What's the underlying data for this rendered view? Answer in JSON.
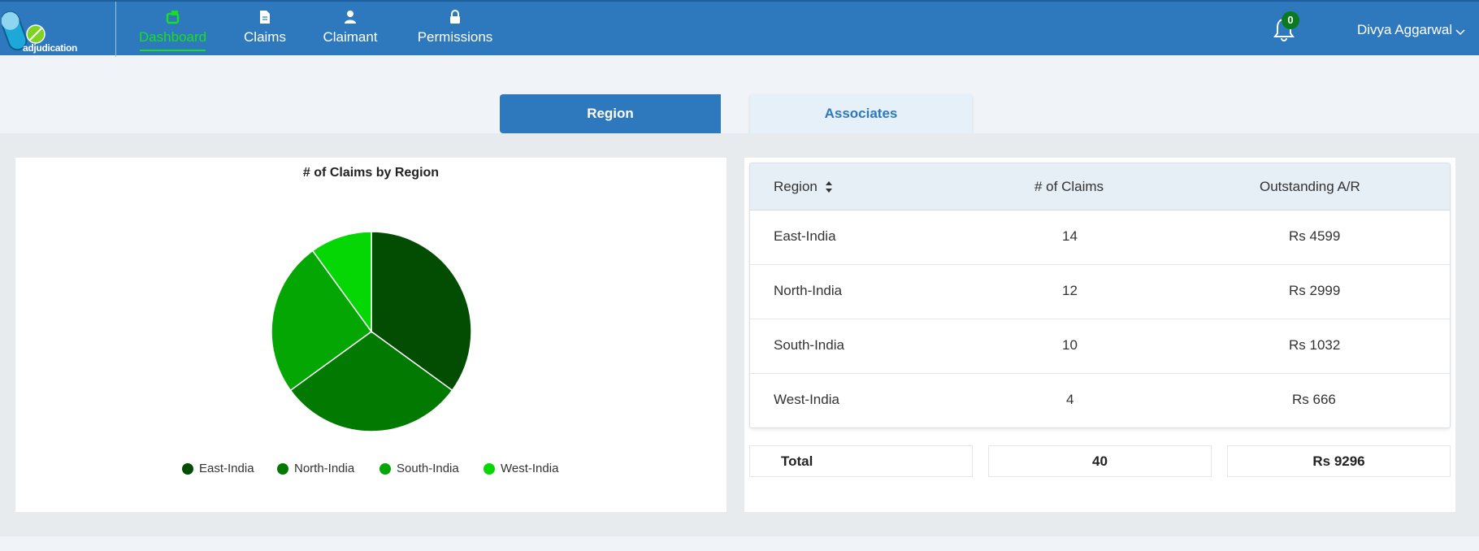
{
  "app": {
    "logo_text": "adjudication"
  },
  "nav": {
    "items": [
      {
        "label": "Dashboard",
        "icon": "dashboard-icon",
        "active": true
      },
      {
        "label": "Claims",
        "icon": "document-icon",
        "active": false
      },
      {
        "label": "Claimant",
        "icon": "user-icon",
        "active": false
      },
      {
        "label": "Permissions",
        "icon": "lock-icon",
        "active": false
      }
    ],
    "active_color": "#19e01c"
  },
  "header": {
    "notification_count": "0",
    "user_name": "Divya Aggarwal"
  },
  "tabs": [
    {
      "label": "Region",
      "active": true
    },
    {
      "label": "Associates",
      "active": false
    }
  ],
  "chart_data": {
    "type": "pie",
    "title": "# of Claims by Region",
    "categories": [
      "East-India",
      "North-India",
      "South-India",
      "West-India"
    ],
    "values": [
      14,
      12,
      10,
      4
    ],
    "colors": [
      "#024d02",
      "#027a02",
      "#03a603",
      "#05d705"
    ],
    "legend": "bottom"
  },
  "table": {
    "headers": [
      "Region",
      "# of Claims",
      "Outstanding A/R"
    ],
    "rows": [
      {
        "region": "East-India",
        "claims": "14",
        "ar": "Rs 4599"
      },
      {
        "region": "North-India",
        "claims": "12",
        "ar": "Rs 2999"
      },
      {
        "region": "South-India",
        "claims": "10",
        "ar": "Rs 1032"
      },
      {
        "region": "West-India",
        "claims": "4",
        "ar": "Rs 666"
      }
    ],
    "total": {
      "label": "Total",
      "claims": "40",
      "ar": "Rs 9296"
    }
  },
  "colors": {
    "primary": "#2e78be",
    "tab_inactive_bg": "#e6f0f9"
  }
}
